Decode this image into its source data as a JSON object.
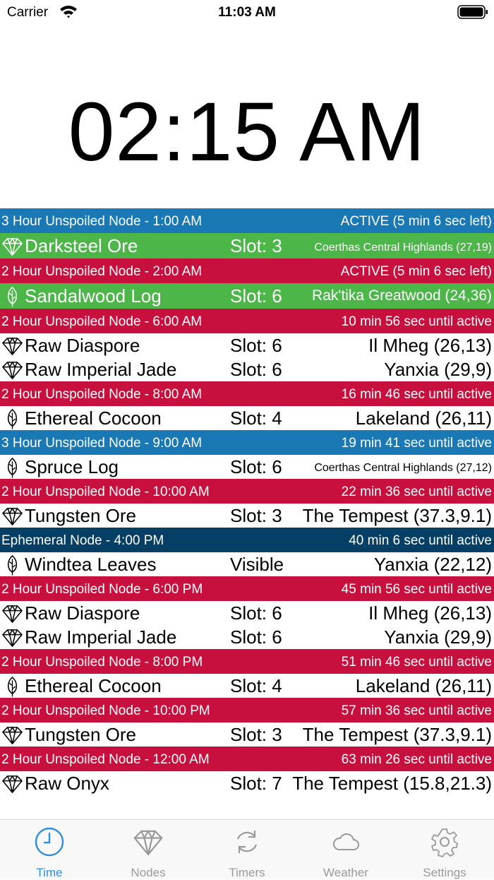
{
  "status_bar": {
    "carrier": "Carrier",
    "time": "11:03 AM"
  },
  "clock": "02:15 AM",
  "groups": [
    {
      "header": "3 Hour Unspoiled Node - 1:00 AM",
      "status": "ACTIVE (5 min 6 sec left)",
      "color": "blue",
      "items": [
        {
          "icon": "gem-icon",
          "name": "Darksteel Ore",
          "slot": "Slot: 3",
          "location": "Coerthas Central Highlands (27,19)",
          "small": true,
          "active": true
        }
      ]
    },
    {
      "header": "2 Hour Unspoiled Node - 2:00 AM",
      "status": "ACTIVE (5 min 6 sec left)",
      "color": "red",
      "items": [
        {
          "icon": "leaf-icon",
          "name": "Sandalwood Log",
          "slot": "Slot: 6",
          "location": "Rak'tika Greatwood (24,36)",
          "small": false,
          "mid": true,
          "active": true
        }
      ]
    },
    {
      "header": "2 Hour Unspoiled Node - 6:00 AM",
      "status": "10 min 56 sec until active",
      "color": "red",
      "items": [
        {
          "icon": "gem-icon",
          "name": "Raw Diaspore",
          "slot": "Slot: 6",
          "location": "Il Mheg (26,13)"
        },
        {
          "icon": "gem-icon",
          "name": "Raw Imperial Jade",
          "slot": "Slot: 6",
          "location": "Yanxia (29,9)"
        }
      ]
    },
    {
      "header": "2 Hour Unspoiled Node - 8:00 AM",
      "status": "16 min 46 sec until active",
      "color": "red",
      "items": [
        {
          "icon": "leaf-icon",
          "name": "Ethereal Cocoon",
          "slot": "Slot: 4",
          "location": "Lakeland (26,11)"
        }
      ]
    },
    {
      "header": "3 Hour Unspoiled Node - 9:00 AM",
      "status": "19 min 41 sec until active",
      "color": "blue",
      "items": [
        {
          "icon": "leaf-icon",
          "name": "Spruce Log",
          "slot": "Slot: 6",
          "location": "Coerthas Central Highlands (27,12)",
          "small": true
        }
      ]
    },
    {
      "header": "2 Hour Unspoiled Node - 10:00 AM",
      "status": "22 min 36 sec until active",
      "color": "red",
      "items": [
        {
          "icon": "gem-icon",
          "name": "Tungsten Ore",
          "slot": "Slot: 3",
          "location": "The Tempest (37.3,9.1)"
        }
      ]
    },
    {
      "header": "Ephemeral Node - 4:00 PM",
      "status": "40 min 6 sec until active",
      "color": "navy",
      "items": [
        {
          "icon": "leaf-icon",
          "name": "Windtea Leaves",
          "slot": "Visible",
          "location": "Yanxia (22,12)"
        }
      ]
    },
    {
      "header": "2 Hour Unspoiled Node - 6:00 PM",
      "status": "45 min 56 sec until active",
      "color": "red",
      "items": [
        {
          "icon": "gem-icon",
          "name": "Raw Diaspore",
          "slot": "Slot: 6",
          "location": "Il Mheg (26,13)"
        },
        {
          "icon": "gem-icon",
          "name": "Raw Imperial Jade",
          "slot": "Slot: 6",
          "location": "Yanxia (29,9)"
        }
      ]
    },
    {
      "header": "2 Hour Unspoiled Node - 8:00 PM",
      "status": "51 min 46 sec until active",
      "color": "red",
      "items": [
        {
          "icon": "leaf-icon",
          "name": "Ethereal Cocoon",
          "slot": "Slot: 4",
          "location": "Lakeland (26,11)"
        }
      ]
    },
    {
      "header": "2 Hour Unspoiled Node - 10:00 PM",
      "status": "57 min 36 sec until active",
      "color": "red",
      "items": [
        {
          "icon": "gem-icon",
          "name": "Tungsten Ore",
          "slot": "Slot: 3",
          "location": "The Tempest (37.3,9.1)"
        }
      ]
    },
    {
      "header": "2 Hour Unspoiled Node - 12:00 AM",
      "status": "63 min 26 sec until active",
      "color": "red",
      "items": [
        {
          "icon": "gem-icon",
          "name": "Raw Onyx",
          "slot": "Slot: 7",
          "location": "The Tempest (15.8,21.3)"
        }
      ]
    }
  ],
  "tabs": [
    {
      "label": "Time",
      "icon": "clock-icon",
      "active": true
    },
    {
      "label": "Nodes",
      "icon": "gem-icon",
      "active": false
    },
    {
      "label": "Timers",
      "icon": "refresh-icon",
      "active": false
    },
    {
      "label": "Weather",
      "icon": "cloud-icon",
      "active": false
    },
    {
      "label": "Settings",
      "icon": "gear-icon",
      "active": false
    }
  ]
}
